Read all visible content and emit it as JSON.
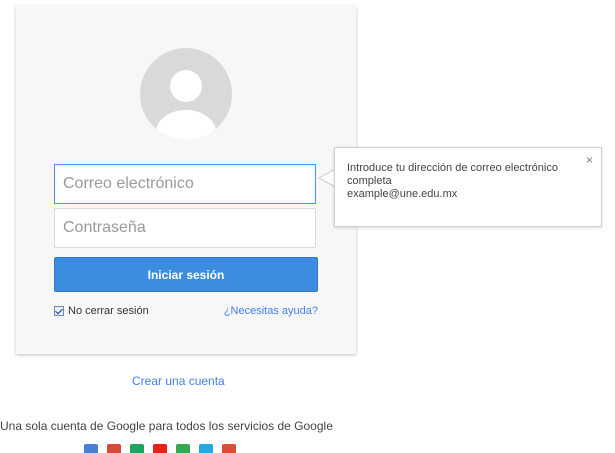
{
  "form": {
    "email_placeholder": "Correo electrónico",
    "password_placeholder": "Contraseña",
    "signin_label": "Iniciar sesión",
    "stay_signed_in_label": "No cerrar sesión",
    "stay_signed_in_checked": true,
    "help_link": "¿Necesitas ayuda?"
  },
  "tooltip": {
    "line1": "Introduce tu dirección de correo electrónico",
    "line2": "completa",
    "line3": "example@une.edu.mx",
    "close_glyph": "×"
  },
  "create_account_link": "Crear una cuenta",
  "tagline": "Una sola cuenta de Google para todos los servicios de Google",
  "app_icons": [
    {
      "name": "google-plus-icon",
      "color": "#4a7fd4"
    },
    {
      "name": "gmail-icon",
      "color": "#d44b3b"
    },
    {
      "name": "drive-icon",
      "color": "#1fa463"
    },
    {
      "name": "youtube-icon",
      "color": "#e62117"
    },
    {
      "name": "maps-icon",
      "color": "#34a853"
    },
    {
      "name": "play-icon",
      "color": "#26a8e0"
    },
    {
      "name": "google-plus-red-icon",
      "color": "#dd4b39"
    }
  ],
  "colors": {
    "accent": "#3c8ce0",
    "link": "#427fed",
    "focus_border": "#4d90fe"
  }
}
